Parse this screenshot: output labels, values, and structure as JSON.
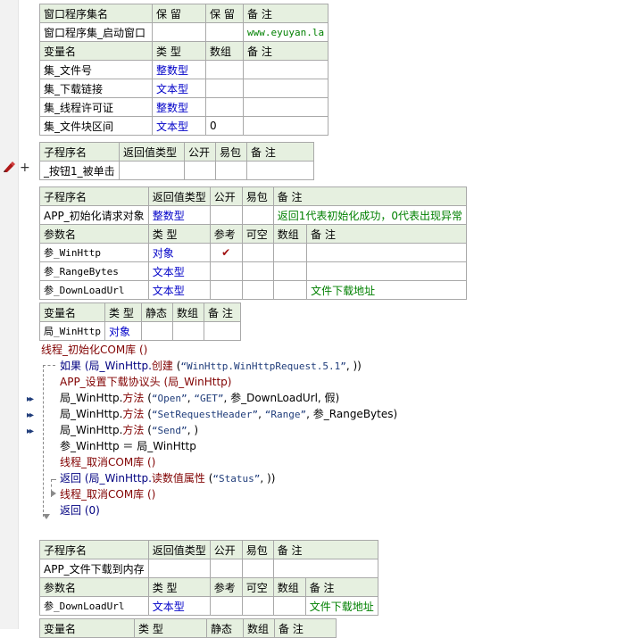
{
  "t1": {
    "header": [
      "窗口程序集名",
      "保 留",
      "保 留",
      "备 注"
    ],
    "row": [
      "窗口程序集_启动窗口",
      "",
      "",
      "www.eyuyan.la"
    ],
    "var_header": [
      "变量名",
      "类 型",
      "数组",
      "备 注"
    ],
    "vars": [
      [
        "集_文件号",
        "整数型",
        "",
        ""
      ],
      [
        "集_下载链接",
        "文本型",
        "",
        ""
      ],
      [
        "集_线程许可证",
        "整数型",
        "",
        ""
      ],
      [
        "集_文件块区间",
        "文本型",
        "0",
        ""
      ]
    ]
  },
  "t2": {
    "header": [
      "子程序名",
      "返回值类型",
      "公开",
      "易包",
      "备 注"
    ],
    "row": [
      "_按钮1_被单击",
      "",
      "",
      "",
      ""
    ]
  },
  "t3": {
    "header": [
      "子程序名",
      "返回值类型",
      "公开",
      "易包",
      "备 注"
    ],
    "row": [
      "APP_初始化请求对象",
      "整数型",
      "",
      "",
      "返回1代表初始化成功，0代表出现异常"
    ],
    "param_header": [
      "参数名",
      "类 型",
      "参考",
      "可空",
      "数组",
      "备 注"
    ],
    "params": [
      [
        "参_WinHttp",
        "对象",
        "✔",
        "",
        "",
        ""
      ],
      [
        "参_RangeBytes",
        "文本型",
        "",
        "",
        "",
        ""
      ],
      [
        "参_DownLoadUrl",
        "文本型",
        "",
        "",
        "",
        "文件下载地址"
      ]
    ]
  },
  "t4": {
    "header": [
      "变量名",
      "类 型",
      "静态",
      "数组",
      "备 注"
    ],
    "row": [
      "局_WinHttp",
      "对象",
      "",
      "",
      ""
    ]
  },
  "code": {
    "l0": "线程_初始化COM库 ()",
    "l1a": "如果 (局_WinHttp.",
    "l1b": "创建",
    "l1c": " (",
    "l1d": "“WinHttp.WinHttpRequest.5.1”",
    "l1e": ", ))",
    "l2": "APP_设置下载协议头 (局_WinHttp)",
    "l3a": "局_WinHttp.",
    "l3b": "方法",
    "l3c": " (",
    "l3d": "“Open”",
    "l3e": ", ",
    "l3f": "“GET”",
    "l3g": ", 参_DownLoadUrl, 假)",
    "l4a": "局_WinHttp.",
    "l4b": "方法",
    "l4c": " (",
    "l4d": "“SetRequestHeader”",
    "l4e": ", ",
    "l4f": "“Range”",
    "l4g": ", 参_RangeBytes)",
    "l5a": "局_WinHttp.",
    "l5b": "方法",
    "l5c": " (",
    "l5d": "“Send”",
    "l5e": ", )",
    "l6": "参_WinHttp ＝ 局_WinHttp",
    "l7": "线程_取消COM库 ()",
    "l8a": "返回 (局_WinHttp.",
    "l8b": "读数值属性",
    "l8c": " (",
    "l8d": "“Status”",
    "l8e": ", ))",
    "l9": "线程_取消COM库 ()",
    "l10": "返回 (0)"
  },
  "t5": {
    "header": [
      "子程序名",
      "返回值类型",
      "公开",
      "易包",
      "备 注"
    ],
    "row": [
      "APP_文件下载到内存",
      "",
      "",
      "",
      ""
    ],
    "param_header": [
      "参数名",
      "类 型",
      "参考",
      "可空",
      "数组",
      "备 注"
    ],
    "params": [
      [
        "参_DownLoadUrl",
        "文本型",
        "",
        "",
        "",
        "文件下载地址"
      ]
    ]
  },
  "t6": {
    "header": [
      "变量名",
      "类 型",
      "静态",
      "数组",
      "备 注"
    ]
  },
  "icons": {
    "pencil": "pencil-icon",
    "plus": "plus-icon",
    "arrow": "double-arrow-icon",
    "check": "check-icon"
  },
  "colors": {
    "header_bg": "#e6f0e0",
    "type_blue": "#0000c8",
    "remark_green": "#008000",
    "func_red": "#800000"
  }
}
